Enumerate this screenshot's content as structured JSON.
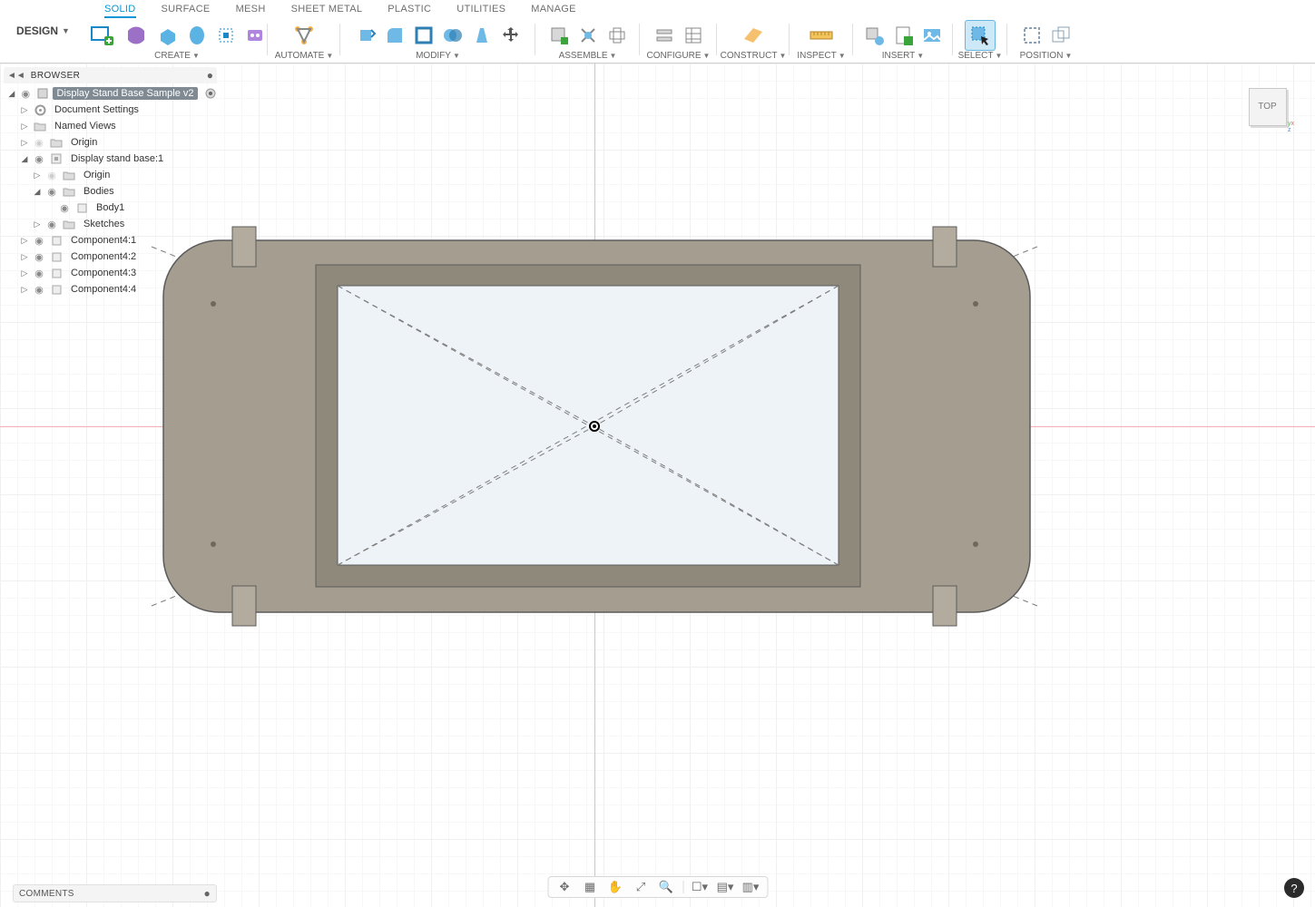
{
  "workspace": {
    "label": "DESIGN"
  },
  "tabs": [
    {
      "label": "SOLID",
      "active": true
    },
    {
      "label": "SURFACE",
      "active": false
    },
    {
      "label": "MESH",
      "active": false
    },
    {
      "label": "SHEET METAL",
      "active": false
    },
    {
      "label": "PLASTIC",
      "active": false
    },
    {
      "label": "UTILITIES",
      "active": false
    },
    {
      "label": "MANAGE",
      "active": false
    }
  ],
  "groups": {
    "create": "CREATE",
    "automate": "AUTOMATE",
    "modify": "MODIFY",
    "assemble": "ASSEMBLE",
    "configure": "CONFIGURE",
    "construct": "CONSTRUCT",
    "inspect": "INSPECT",
    "insert": "INSERT",
    "select": "SELECT",
    "position": "POSITION"
  },
  "browser": {
    "title": "BROWSER",
    "root": "Display Stand Base Sample v2",
    "items": [
      {
        "label": "Document Settings"
      },
      {
        "label": "Named Views"
      },
      {
        "label": "Origin"
      },
      {
        "label": "Display stand base:1"
      },
      {
        "label": "Origin"
      },
      {
        "label": "Bodies"
      },
      {
        "label": "Body1"
      },
      {
        "label": "Sketches"
      },
      {
        "label": "Component4:1"
      },
      {
        "label": "Component4:2"
      },
      {
        "label": "Component4:3"
      },
      {
        "label": "Component4:4"
      }
    ]
  },
  "viewcube": {
    "face": "TOP"
  },
  "comments": {
    "title": "COMMENTS"
  },
  "colors": {
    "body": "#a59e90",
    "border": "#5b5b5b",
    "frame": "#8f897c",
    "screen": "#eef3f8",
    "tab": "#b3ac9e"
  }
}
